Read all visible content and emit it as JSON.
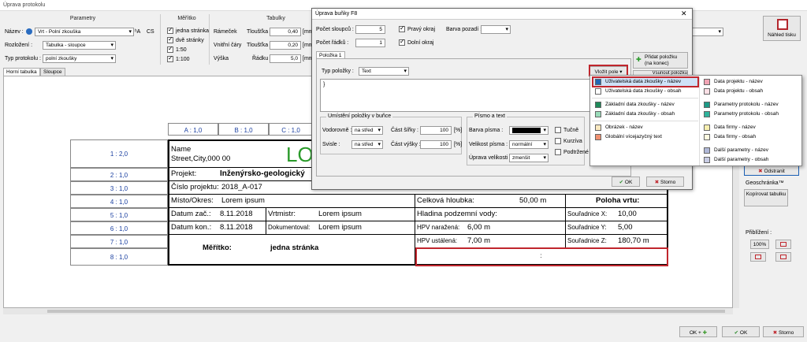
{
  "window": {
    "title": "Úprava protokolu"
  },
  "params": {
    "title": "Parametry",
    "name_label": "Název :",
    "name_value": "Vrt - Polní zkouška",
    "cs": "CS",
    "layout_label": "Rozložení :",
    "layout_value": "Tabulka - sloupce",
    "type_label": "Typ protokolu :",
    "type_value": "polní zkoušky"
  },
  "scale": {
    "title": "Měřítko",
    "opt1": "jedna stránka",
    "opt2": "dvě stránky",
    "opt3": "1:50",
    "opt4": "1:100"
  },
  "tables": {
    "title": "Tabulky",
    "frame": "Rámeček",
    "inner": "Vnitřní čáry",
    "height": "Výška",
    "thick1": "Tloušťka :",
    "thick1_val": "0,40",
    "thick2": "Tloušťka :",
    "thick2_val": "0,20",
    "rows": "Řádku :",
    "rows_val": "5,0",
    "unit": "[mm]"
  },
  "preview_btn": "Náhled tisku",
  "tabs": [
    "Horní tabulka",
    "Sloupce"
  ],
  "colhdrs": [
    "A : 1,0",
    "B : 1,0",
    "C : 1,0"
  ],
  "rowhdrs": [
    "1 : 2,0",
    "2 : 1,0",
    "3 : 1,0",
    "4 : 1,0",
    "5 : 1,0",
    "6 : 1,0",
    "7 : 1,0",
    "8 : 1,0"
  ],
  "table": {
    "name": "Name",
    "street": "Street,City,000 00",
    "logo": "LO",
    "projekt_l": "Projekt:",
    "projekt_v": "Inženýrsko-geologický",
    "cislo_l": "Číslo projektu:",
    "cislo_v": "2018_A-017",
    "misto_l": "Místo/Okres:",
    "misto_v": "Lorem ipsum",
    "datz_l": "Datum zač.:",
    "datz_v": "8.11.2018",
    "vrt_l": "Vrtmistr:",
    "vrt_v": "Lorem ipsum",
    "datk_l": "Datum kon.:",
    "datk_v": "8.11.2018",
    "dok_l": "Dokumentoval:",
    "dok_v": "Lorem ipsum",
    "mer_l": "Měřítko:",
    "mer_v": "jedna stránka",
    "hloub_l": "Celková hloubka:",
    "hloub_v": "50,00 m",
    "hpv_l": "Hladina podzemní vody:",
    "nar_l": "HPV naražená:",
    "nar_v": "6,00 m",
    "ust_l": "HPV ustálená:",
    "ust_v": "7,00 m",
    "poloha": "Poloha vrtu:",
    "sx_l": "Souřadnice X:",
    "sx_v": "10,00",
    "sy_l": "Souřadnice Y:",
    "sy_v": "5,00",
    "sz_l": "Souřadnice Z:",
    "sz_v": "180,70 m",
    "colon": ":"
  },
  "dialog": {
    "title": "Úprava buňky F8",
    "cols_l": "Počet sloupců :",
    "cols_v": "5",
    "rows_l": "Počet řádků :",
    "rows_v": "1",
    "right": "Pravý okraj",
    "bottom": "Dolní okraj",
    "bg": "Barva pozadí :",
    "tab": "Položka 1",
    "add": "Přidat položku (na konec)",
    "ins": "Vsunout položku",
    "type_l": "Typ položky :",
    "type_v": "Text",
    "insert": "Vložit pole",
    "text": "}",
    "pos_title": "Umístění položky v buňce",
    "h_l": "Vodorovně :",
    "h_v": "na střed",
    "cw_l": "Část šířky :",
    "cw_v": "100",
    "v_l": "Svisle :",
    "v_v": "na střed",
    "ch_l": "Část výšky :",
    "ch_v": "100",
    "pct": "[%]",
    "font_title": "Písmo a text",
    "color_l": "Barva písma :",
    "size_l": "Velikost písma :",
    "size_v": "normální",
    "adj_l": "Úprava velikosti :",
    "adj_v": "zmenšit",
    "bold": "Tučně",
    "italic": "Kurzíva",
    "under": "Podtržené",
    "ok": "OK",
    "cancel": "Storno"
  },
  "menu": [
    {
      "label": "Uživatelská data zkoušky - název",
      "color": "#1f66b3"
    },
    {
      "label": "Uživatelská data zkoušky - obsah",
      "color": "#ffffff"
    },
    {
      "label": "Základní data zkoušky - název",
      "color": "#1f8a5a"
    },
    {
      "label": "Základní data zkoušky - obsah",
      "color": "#9adbb9"
    },
    {
      "label": "Obrázek - název",
      "color": "#fbe9c0"
    },
    {
      "label": "Globální vícejazyčný text",
      "color": "#f09070"
    },
    {
      "label": "Data projektu - název",
      "color": "#f2a4b4"
    },
    {
      "label": "Data projektu - obsah",
      "color": "#fde0e6"
    },
    {
      "label": "Parametry protokolu - název",
      "color": "#1d9a86"
    },
    {
      "label": "Parametry protokolu - obsah",
      "color": "#2fb39c"
    },
    {
      "label": "Data firmy - název",
      "color": "#f8f0b0"
    },
    {
      "label": "Data firmy - obsah",
      "color": "#fffbe0"
    },
    {
      "label": "Další parametry - název",
      "color": "#b0b8d8"
    },
    {
      "label": "Další parametry - obsah",
      "color": "#c8cce4"
    }
  ],
  "right_panel": {
    "remove": "Odstranit",
    "geo": "Geoschránka™",
    "copy": "Kopírovat tabulku",
    "zoom": "Přiblížení :",
    "zoom_v": "100%"
  },
  "bottom": {
    "ok_plus": "OK +",
    "ok": "OK",
    "cancel": "Storno"
  }
}
